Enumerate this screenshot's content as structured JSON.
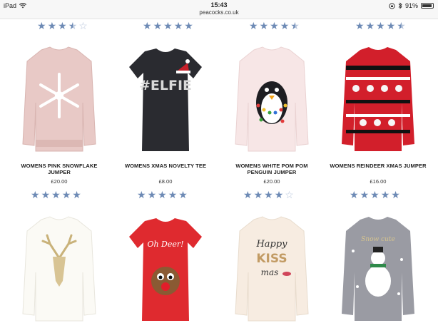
{
  "status": {
    "device": "iPad",
    "time": "15:43",
    "url": "peacocks.co.uk",
    "battery": "91%"
  },
  "rows": [
    {
      "ratings_top": [
        3.5,
        5,
        4.5,
        4.5
      ]
    }
  ],
  "products": [
    {
      "name_line1": "WOMENS PINK SNOWFLAKE",
      "name_line2": "JUMPER",
      "price": "£20.00",
      "rating": 5,
      "image": "pink-snowflake-jumper"
    },
    {
      "name_line1": "WOMENS XMAS NOVELTY TEE",
      "name_line2": "",
      "price": "£8.00",
      "rating": 5,
      "image": "elfie-tee"
    },
    {
      "name_line1": "WOMENS WHITE POM POM",
      "name_line2": "PENGUIN JUMPER",
      "price": "£20.00",
      "rating": 4,
      "image": "penguin-jumper"
    },
    {
      "name_line1": "WOMENS REINDEER XMAS JUMPER",
      "name_line2": "",
      "price": "£16.00",
      "rating": 5,
      "image": "reindeer-jumper"
    },
    {
      "name_line1": "",
      "name_line2": "",
      "price": "",
      "rating": null,
      "image": "sequin-stag-jumper",
      "print": ""
    },
    {
      "name_line1": "",
      "name_line2": "",
      "price": "",
      "rating": null,
      "image": "oh-deer-tee",
      "print": "Oh Deer!"
    },
    {
      "name_line1": "",
      "name_line2": "",
      "price": "",
      "rating": null,
      "image": "happy-kiss-mas-jumper",
      "print_lines": [
        "Happy",
        "KISS",
        "mas"
      ]
    },
    {
      "name_line1": "",
      "name_line2": "",
      "price": "",
      "rating": null,
      "image": "snowman-jumper",
      "print": "Snow cute"
    }
  ],
  "colors": {
    "star": "#6d8ab5",
    "star_empty": "#b8c6dc"
  }
}
